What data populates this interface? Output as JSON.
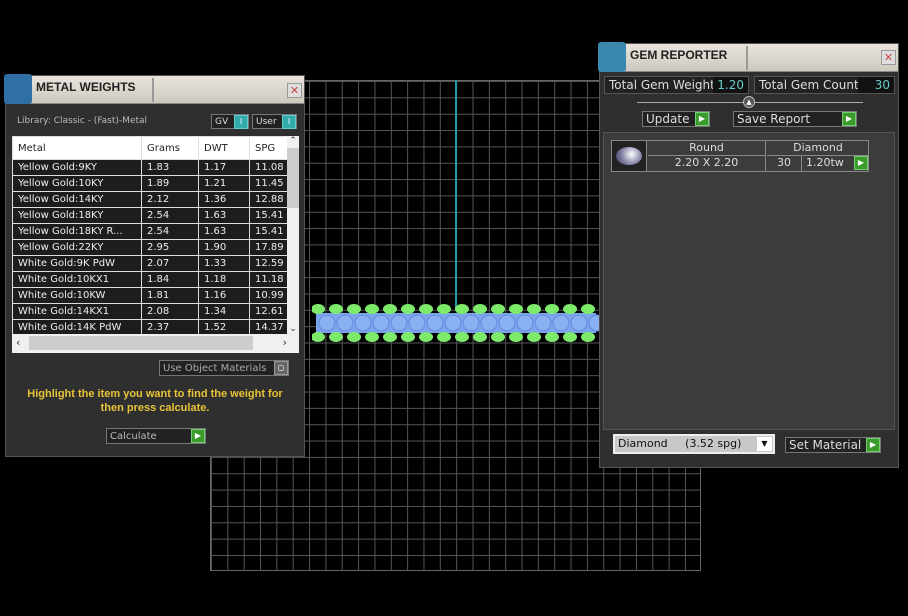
{
  "metal_weights": {
    "title": "METAL WEIGHTS",
    "library": "Library: Classic - (Fast)-Metal",
    "gv_label": "GV",
    "user_label": "User",
    "columns": [
      "Metal",
      "Grams",
      "DWT",
      "SPG"
    ],
    "rows": [
      [
        "Yellow Gold:9KY",
        "1.83",
        "1.17",
        "11.08"
      ],
      [
        "Yellow Gold:10KY",
        "1.89",
        "1.21",
        "11.45"
      ],
      [
        "Yellow Gold:14KY",
        "2.12",
        "1.36",
        "12.88"
      ],
      [
        "Yellow Gold:18KY",
        "2.54",
        "1.63",
        "15.41"
      ],
      [
        "Yellow Gold:18KY R...",
        "2.54",
        "1.63",
        "15.41"
      ],
      [
        "Yellow Gold:22KY",
        "2.95",
        "1.90",
        "17.89"
      ],
      [
        "White Gold:9K PdW",
        "2.07",
        "1.33",
        "12.59"
      ],
      [
        "White Gold:10KX1",
        "1.84",
        "1.18",
        "11.18"
      ],
      [
        "White Gold:10KW",
        "1.81",
        "1.16",
        "10.99"
      ],
      [
        "White Gold:14KX1",
        "2.08",
        "1.34",
        "12.61"
      ],
      [
        "White Gold:14K PdW",
        "2.37",
        "1.52",
        "14.37"
      ]
    ],
    "use_object_materials": "Use Object Materials",
    "hint": "Highlight the item you want to find the weight for then press calculate.",
    "calculate": "Calculate"
  },
  "gem_reporter": {
    "title": "GEM REPORTER",
    "total_weight_label": "Total Gem Weight",
    "total_weight": "1.20",
    "total_count_label": "Total Gem Count",
    "total_count": "30",
    "update": "Update",
    "save_report": "Save Report",
    "gem": {
      "shape": "Round",
      "material": "Diamond",
      "size": "2.20 X 2.20",
      "count": "30",
      "weight": "1.20tw"
    },
    "material_select": "Diamond     (3.52 spg)",
    "set_material": "Set Material"
  }
}
